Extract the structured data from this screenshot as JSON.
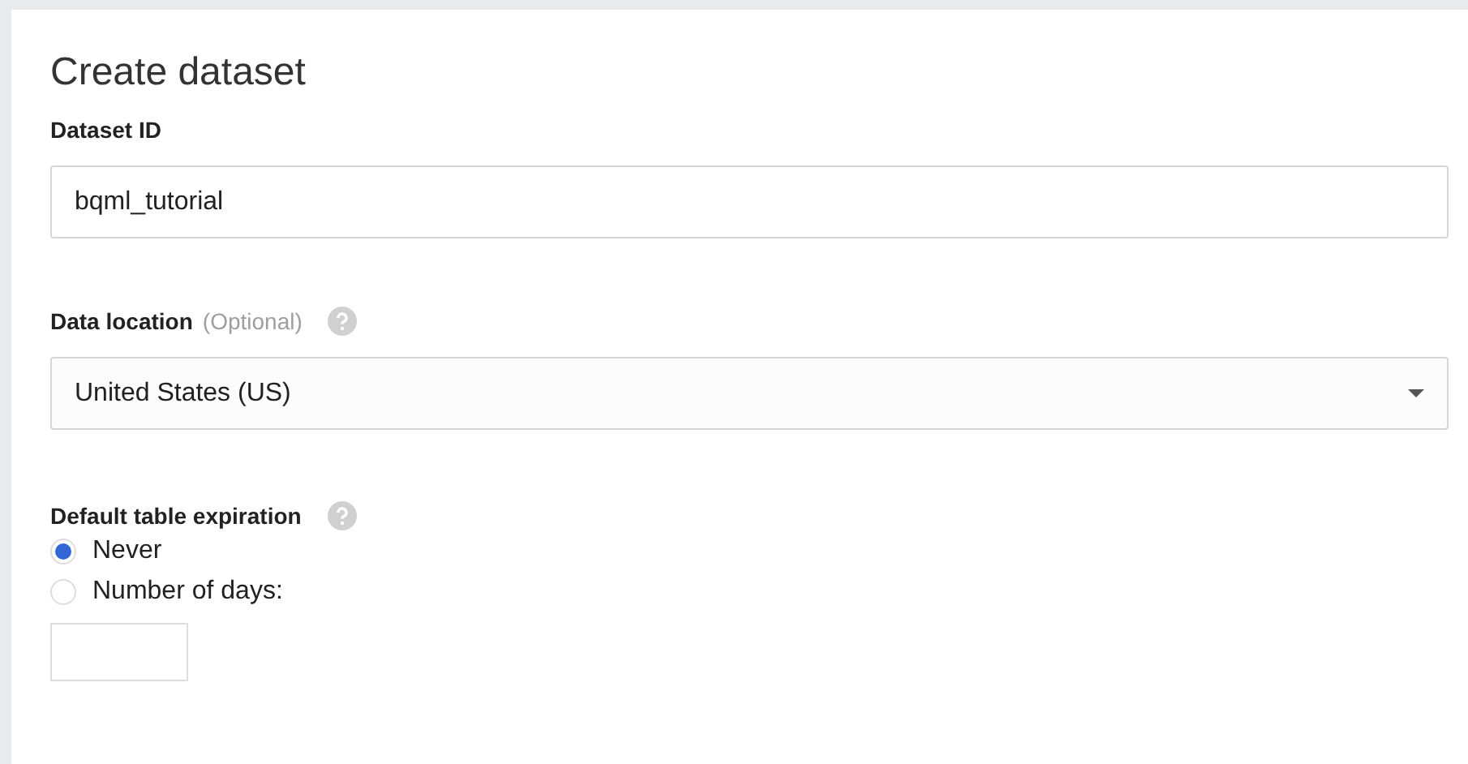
{
  "title": "Create dataset",
  "dataset_id": {
    "label": "Dataset ID",
    "value": "bqml_tutorial"
  },
  "data_location": {
    "label": "Data location",
    "hint": "(Optional)",
    "value": "United States (US)"
  },
  "expiration": {
    "label": "Default table expiration",
    "options": [
      {
        "label": "Never",
        "selected": true
      },
      {
        "label": "Number of days:",
        "selected": false
      }
    ]
  }
}
